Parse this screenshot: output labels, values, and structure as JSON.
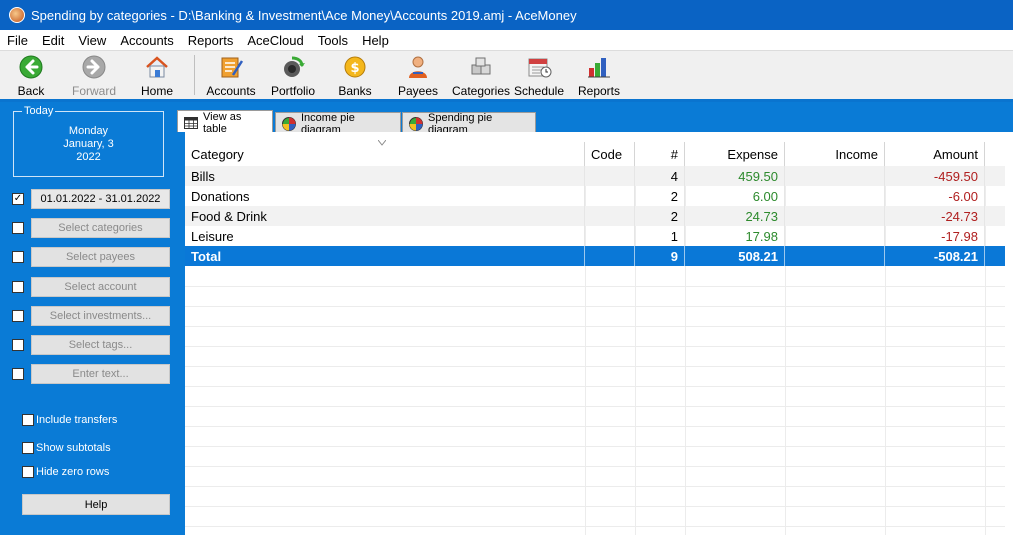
{
  "window": {
    "title": "Spending by categories - D:\\Banking & Investment\\Ace Money\\Accounts 2019.amj - AceMoney"
  },
  "menu": [
    "File",
    "Edit",
    "View",
    "Accounts",
    "Reports",
    "AceCloud",
    "Tools",
    "Help"
  ],
  "toolbar": {
    "back": "Back",
    "forward": "Forward",
    "home": "Home",
    "accounts": "Accounts",
    "portfolio": "Portfolio",
    "banks": "Banks",
    "payees": "Payees",
    "categories": "Categories",
    "schedule": "Schedule",
    "reports": "Reports"
  },
  "sidebar": {
    "today_label": "Today",
    "today_weekday": "Monday",
    "today_date": "January, 3",
    "today_year": "2022",
    "date_range": "01.01.2022 - 31.01.2022",
    "date_range_checked": true,
    "select_categories": "Select categories",
    "select_payees": "Select payees",
    "select_account": "Select account",
    "select_investments": "Select investments...",
    "select_tags": "Select tags...",
    "enter_text": "Enter text...",
    "include_transfers": "Include transfers",
    "show_subtotals": "Show subtotals",
    "hide_zero_rows": "Hide zero rows",
    "help": "Help"
  },
  "tabs": {
    "view_as_table": "View as table",
    "income_pie": "Income pie diagram",
    "spending_pie": "Spending pie diagram"
  },
  "table": {
    "headers": {
      "category": "Category",
      "code": "Code",
      "count": "#",
      "expense": "Expense",
      "income": "Income",
      "amount": "Amount"
    },
    "rows": [
      {
        "category": "Bills",
        "code": "",
        "count": "4",
        "expense": "459.50",
        "income": "",
        "amount": "-459.50"
      },
      {
        "category": "Donations",
        "code": "",
        "count": "2",
        "expense": "6.00",
        "income": "",
        "amount": "-6.00"
      },
      {
        "category": "Food & Drink",
        "code": "",
        "count": "2",
        "expense": "24.73",
        "income": "",
        "amount": "-24.73"
      },
      {
        "category": "Leisure",
        "code": "",
        "count": "1",
        "expense": "17.98",
        "income": "",
        "amount": "-17.98"
      }
    ],
    "total": {
      "category": "Total",
      "code": "",
      "count": "9",
      "expense": "508.21",
      "income": "",
      "amount": "-508.21"
    }
  },
  "colors": {
    "accent_blue": "#0a7bd6",
    "expense_green": "#2d8a2d",
    "amount_red": "#b02020"
  }
}
